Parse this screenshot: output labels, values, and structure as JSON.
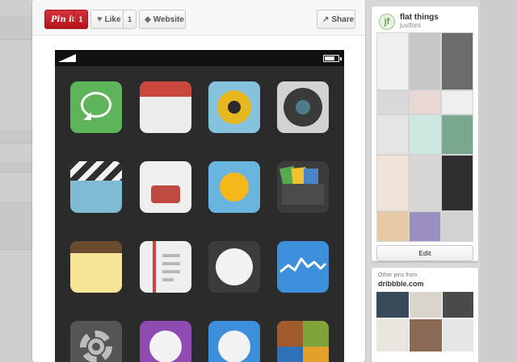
{
  "toolbar": {
    "pinit_label": "Pin it",
    "pinit_count": "1",
    "like_label": "Like",
    "like_count": "1",
    "website_label": "Website",
    "share_label": "Share"
  },
  "icons": {
    "like": "heart-icon",
    "website": "website-icon",
    "share": "share-icon"
  },
  "phone_apps": [
    "messages",
    "calendar",
    "music",
    "camera",
    "videos",
    "notes",
    "weather",
    "wallet",
    "notepad",
    "reader",
    "clock",
    "stocks",
    "settings",
    "purple-app",
    "blue-app",
    "windows-app"
  ],
  "board": {
    "avatar_letter": "jf",
    "title": "flat things",
    "user": "justfont",
    "edit_label": "Edit"
  },
  "other_pins": {
    "label": "Other pins from",
    "source": "dribbble.com"
  },
  "colors": {
    "pinit_red": "#c9222b",
    "phone_bg": "#2b2b2b"
  }
}
